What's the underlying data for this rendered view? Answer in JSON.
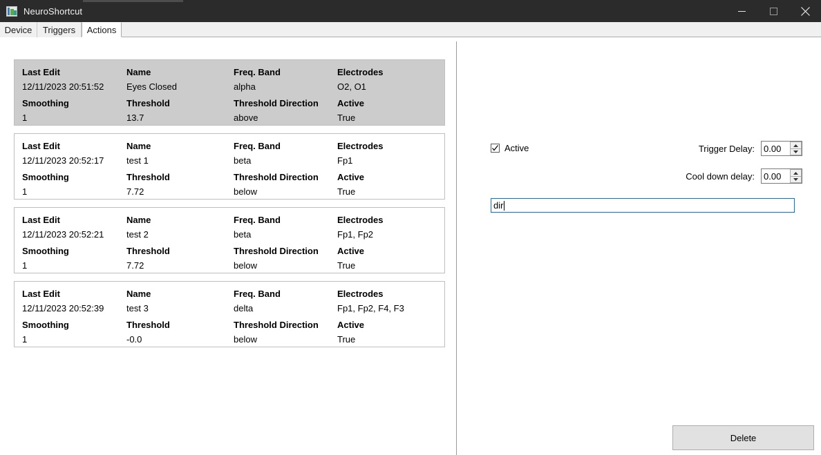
{
  "window": {
    "title": "NeuroShortcut",
    "icon": "app-image-icon",
    "controls": {
      "minimize": "minimize-icon",
      "maximize": "maximize-icon",
      "close": "close-icon"
    }
  },
  "tabs": [
    {
      "label": "Device",
      "selected": false
    },
    {
      "label": "Triggers",
      "selected": false
    },
    {
      "label": "Actions",
      "selected": true
    }
  ],
  "actions": {
    "field_labels": {
      "last_edit": "Last Edit",
      "name": "Name",
      "freq_band": "Freq. Band",
      "electrodes": "Electrodes",
      "smoothing": "Smoothing",
      "threshold": "Threshold",
      "threshold_direction": "Threshold Direction",
      "active": "Active"
    },
    "items": [
      {
        "selected": true,
        "last_edit": "12/11/2023 20:51:52",
        "name": "Eyes Closed",
        "freq_band": "alpha",
        "electrodes": "O2, O1",
        "smoothing": "1",
        "threshold": "13.7",
        "threshold_direction": "above",
        "active": "True"
      },
      {
        "selected": false,
        "last_edit": "12/11/2023 20:52:17",
        "name": "test 1",
        "freq_band": "beta",
        "electrodes": "Fp1",
        "smoothing": "1",
        "threshold": "7.72",
        "threshold_direction": "below",
        "active": "True"
      },
      {
        "selected": false,
        "last_edit": "12/11/2023 20:52:21",
        "name": "test 2",
        "freq_band": "beta",
        "electrodes": "Fp1, Fp2",
        "smoothing": "1",
        "threshold": "7.72",
        "threshold_direction": "below",
        "active": "True"
      },
      {
        "selected": false,
        "last_edit": "12/11/2023 20:52:39",
        "name": "test 3",
        "freq_band": "delta",
        "electrodes": "Fp1, Fp2, F4, F3",
        "smoothing": "1",
        "threshold": "-0.0",
        "threshold_direction": "below",
        "active": "True"
      }
    ]
  },
  "editor": {
    "active_checkbox": {
      "label": "Active",
      "checked": true,
      "icon": "checkmark-icon"
    },
    "trigger_delay": {
      "label": "Trigger Delay:",
      "value": "0.00"
    },
    "cool_down_delay": {
      "label": "Cool down delay:",
      "value": "0.00"
    },
    "command_input": {
      "value": "dir",
      "placeholder": "",
      "focused": true
    },
    "delete_button": {
      "label": "Delete"
    }
  },
  "colors": {
    "titlebar": "#2b2b2b",
    "selected_card": "#cccccc",
    "focus_border": "#0078d7",
    "button_face": "#e1e1e1"
  }
}
